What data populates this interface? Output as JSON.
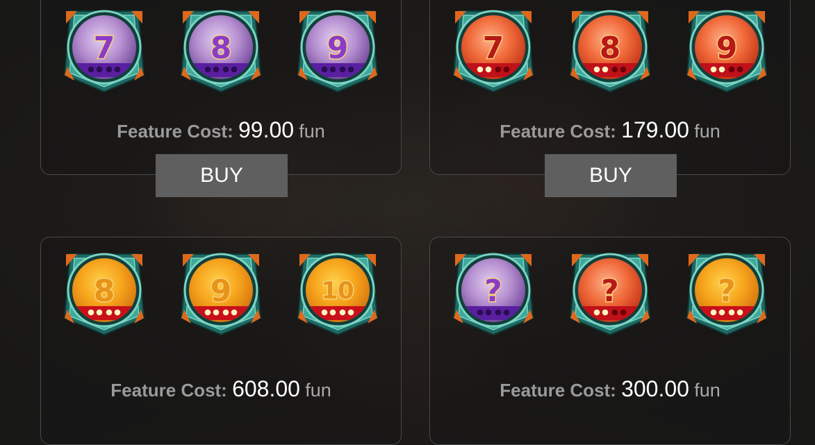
{
  "features": [
    {
      "cost_label": "Feature Cost:",
      "cost_value": "99.00",
      "unit": "fun",
      "buy_label": "BUY",
      "symbols": [
        {
          "glyph": "7",
          "theme": "purple",
          "lit_dots": 0
        },
        {
          "glyph": "8",
          "theme": "purple",
          "lit_dots": 0
        },
        {
          "glyph": "9",
          "theme": "purple",
          "lit_dots": 0
        }
      ]
    },
    {
      "cost_label": "Feature Cost:",
      "cost_value": "179.00",
      "unit": "fun",
      "buy_label": "BUY",
      "symbols": [
        {
          "glyph": "7",
          "theme": "red",
          "lit_dots": 2
        },
        {
          "glyph": "8",
          "theme": "red",
          "lit_dots": 2
        },
        {
          "glyph": "9",
          "theme": "red",
          "lit_dots": 2
        }
      ]
    },
    {
      "cost_label": "Feature Cost:",
      "cost_value": "608.00",
      "unit": "fun",
      "symbols": [
        {
          "glyph": "8",
          "theme": "gold",
          "lit_dots": 4
        },
        {
          "glyph": "9",
          "theme": "gold",
          "lit_dots": 4
        },
        {
          "glyph": "10",
          "theme": "gold",
          "lit_dots": 4
        }
      ]
    },
    {
      "cost_label": "Feature Cost:",
      "cost_value": "300.00",
      "unit": "fun",
      "symbols": [
        {
          "glyph": "?",
          "theme": "purple",
          "lit_dots": 0
        },
        {
          "glyph": "?",
          "theme": "red",
          "lit_dots": 2
        },
        {
          "glyph": "?",
          "theme": "gold",
          "lit_dots": 4
        }
      ]
    }
  ],
  "themes": {
    "purple": {
      "light": "#e2cfee",
      "mid": "#b58fd0",
      "dark": "#7a4fa0",
      "band": "#5a1fa0",
      "dot": "#2e0f5a",
      "glyph": "#8a3cc8"
    },
    "red": {
      "light": "#ffb08a",
      "mid": "#f06a3a",
      "dark": "#c83a1a",
      "band": "#c0101a",
      "dot": "#6a0008",
      "glyph": "#b81818"
    },
    "gold": {
      "light": "#ffd24a",
      "mid": "#f6a41c",
      "dark": "#d87810",
      "band": "#c8101a",
      "dot": "#6a0008",
      "glyph": "#e89418"
    }
  },
  "frame_colors": {
    "outer": "#1f6a64",
    "mid": "#3fa89a",
    "inner": "#7ad4c4",
    "corner": "#e0681c"
  }
}
